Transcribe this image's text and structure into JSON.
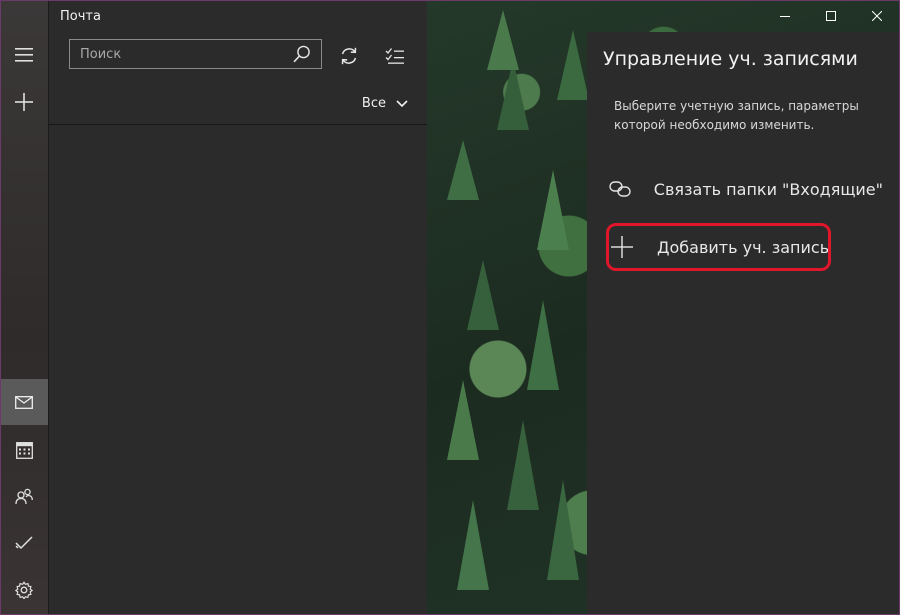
{
  "app": {
    "title": "Почта"
  },
  "rail": {
    "items": [
      {
        "name": "hamburger-icon"
      },
      {
        "name": "plus-icon"
      },
      {
        "name": "mail-icon",
        "active": true
      },
      {
        "name": "calendar-icon"
      },
      {
        "name": "people-icon"
      },
      {
        "name": "todo-icon"
      },
      {
        "name": "settings-icon"
      }
    ]
  },
  "list": {
    "search_placeholder": "Поиск",
    "search_value": "",
    "filter_label": "Все"
  },
  "window": {
    "controls": [
      "minimize",
      "maximize",
      "close"
    ]
  },
  "flyout": {
    "title": "Управление уч. записями",
    "description": "Выберите учетную запись, параметры которой необходимо изменить.",
    "items": [
      {
        "icon": "link-icon",
        "label": "Связать папки \"Входящие\""
      },
      {
        "icon": "plus-icon",
        "label": "Добавить уч. запись"
      }
    ]
  },
  "colors": {
    "highlight": "#e0162b",
    "pane": "#2b2b2b",
    "active_nav": "#5a5a5a"
  }
}
